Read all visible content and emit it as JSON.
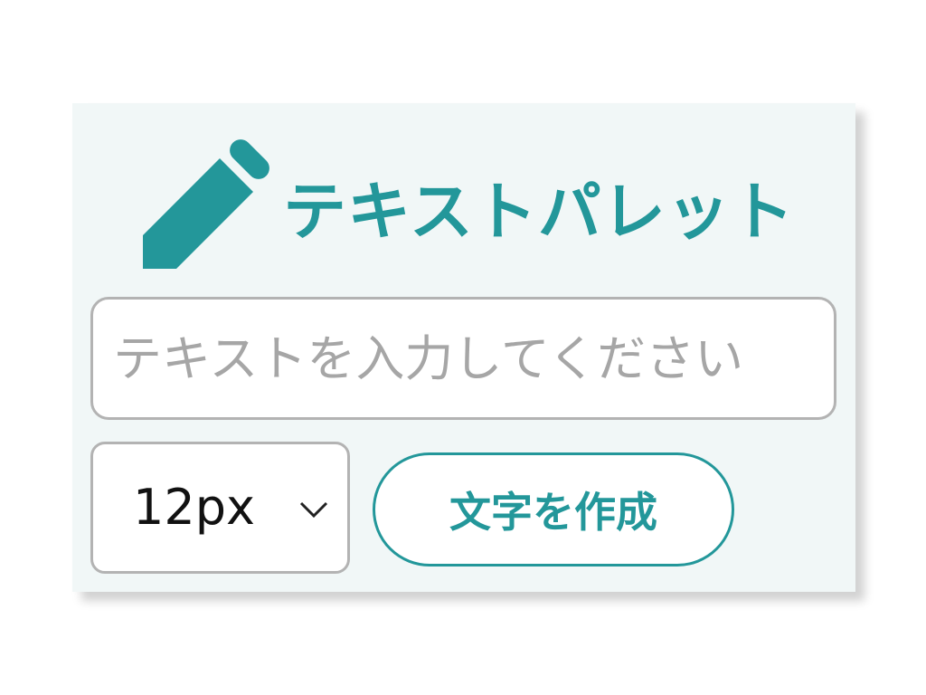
{
  "palette": {
    "title": "テキストパレット",
    "icon": "pencil-icon",
    "accent_color": "#23979a"
  },
  "text_input": {
    "value": "",
    "placeholder": "テキストを入力してください"
  },
  "font_size_select": {
    "selected": "12px"
  },
  "create_button": {
    "label": "文字を作成"
  }
}
